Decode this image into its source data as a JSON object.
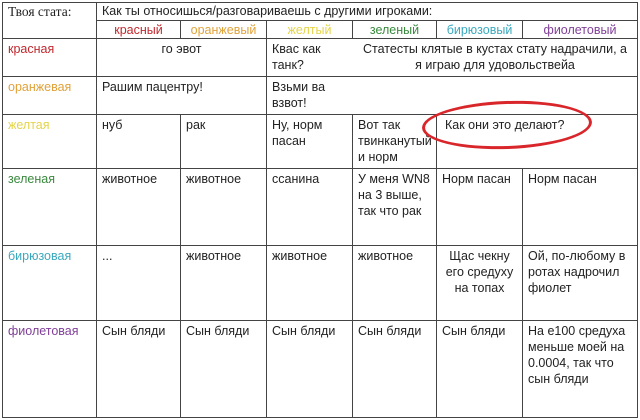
{
  "colors": {
    "red": "#c0282d",
    "orange": "#e0a23a",
    "yellow": "#e5d44a",
    "green": "#3a8a3e",
    "turquoise": "#3aa9bd",
    "purple": "#7f3f98",
    "circle": "#d8262b"
  },
  "header": {
    "corner": "Твоя стата:",
    "question": "Как ты относишься/разговариваешь с другими игроками:",
    "columns": [
      "красный",
      "оранжевый",
      "желтый",
      "зеленый",
      "бирюзовый",
      "фиолетовый"
    ]
  },
  "rows": [
    {
      "label": "красная",
      "cells": [
        "го эвот",
        "Квас как танк?",
        "Статесты клятые в кустах стату надрачили, а я играю для удовольствейа"
      ]
    },
    {
      "label": "оранжевая",
      "cells": [
        "Рашим пацентру!",
        "Взьми ва взвот!"
      ]
    },
    {
      "label": "желтая",
      "cells": [
        "нуб",
        "рак",
        "Ну, норм пасан",
        "Вот так твинканутый и норм",
        "Как они это делают?"
      ]
    },
    {
      "label": "зеленая",
      "cells": [
        "животное",
        "животное",
        "ссанина",
        "У меня WN8 на 3 выше, так что рак",
        "Норм пасан",
        "Норм пасан"
      ]
    },
    {
      "label": "бирюзовая",
      "cells": [
        "...",
        "животное",
        "животное",
        "животное",
        "Щас чекну его средуху на топах",
        "Ой, по-любому в ротах надрочил фиолет"
      ]
    },
    {
      "label": "фиолетовая",
      "cells": [
        "Сын бляди",
        "Сын бляди",
        "Сын бляди",
        "Сын бляди",
        "Сын бляди",
        "На е100 средуха меньше моей на 0.0004, так что сын бляди"
      ]
    }
  ]
}
